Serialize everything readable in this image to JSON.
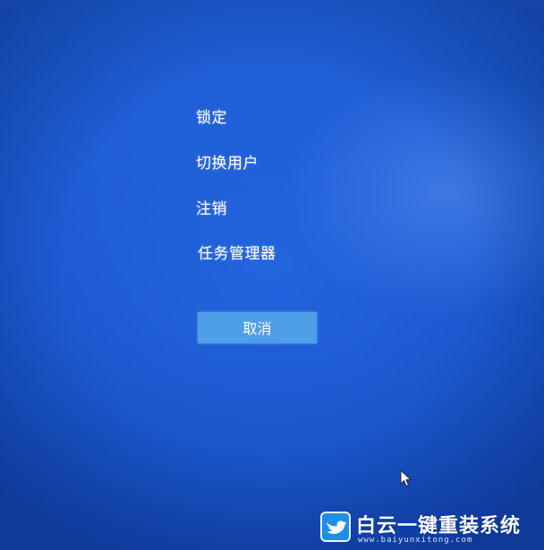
{
  "menu": {
    "items": [
      {
        "label": "锁定"
      },
      {
        "label": "切换用户"
      },
      {
        "label": "注销"
      },
      {
        "label": "任务管理器"
      }
    ],
    "cancel_label": "取消"
  },
  "watermark": {
    "title": "白云一键重装系统",
    "url": "www.baiyunxitong.com"
  },
  "colors": {
    "background": "#1c5bd0",
    "button": "#4e9fe6",
    "text": "#ffffff"
  },
  "icons": {
    "cursor": "mouse-pointer-icon",
    "logo": "bird-logo-icon"
  }
}
